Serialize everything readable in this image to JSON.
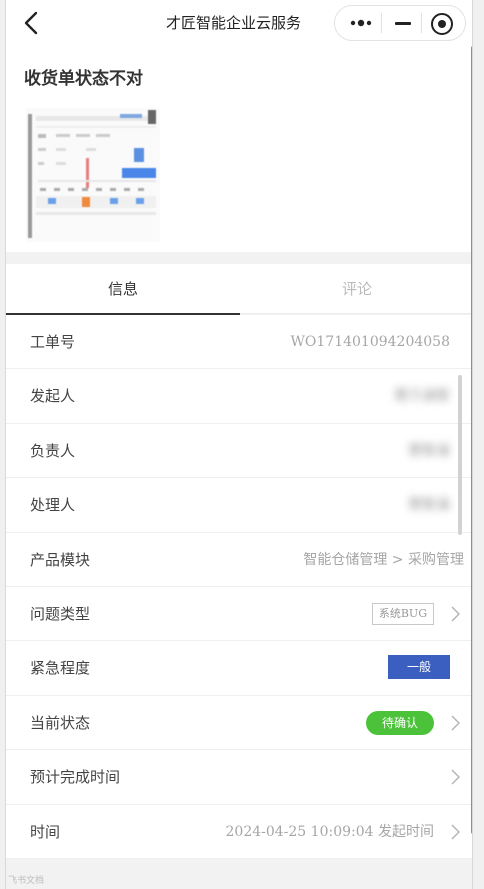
{
  "navbar": {
    "title": "才匠智能企业云服务"
  },
  "ticket": {
    "title": "收货单状态不对"
  },
  "tabs": [
    {
      "label": "信息"
    },
    {
      "label": "评论"
    }
  ],
  "fields": {
    "ticket_no": {
      "label": "工单号",
      "value": "WO171401094204058"
    },
    "initiator": {
      "label": "发起人",
      "value": "慧万涵智"
    },
    "owner": {
      "label": "负责人",
      "value": "慧智涵"
    },
    "handler": {
      "label": "处理人",
      "value": "慧智涵"
    },
    "module": {
      "label": "产品模块",
      "value": "智能仓储管理 > 采购管理"
    },
    "issue_type": {
      "label": "问题类型",
      "value": "系统BUG"
    },
    "urgency": {
      "label": "紧急程度",
      "value": "一般"
    },
    "status": {
      "label": "当前状态",
      "value": "待确认"
    },
    "eta": {
      "label": "预计完成时间",
      "value": ""
    },
    "time": {
      "label": "时间",
      "value": "2024-04-25 10:09:04 发起时间"
    }
  },
  "colors": {
    "urgency_tag": "#3b5fc0",
    "status_tag": "#4cc23a"
  },
  "watermark": "飞书文档"
}
